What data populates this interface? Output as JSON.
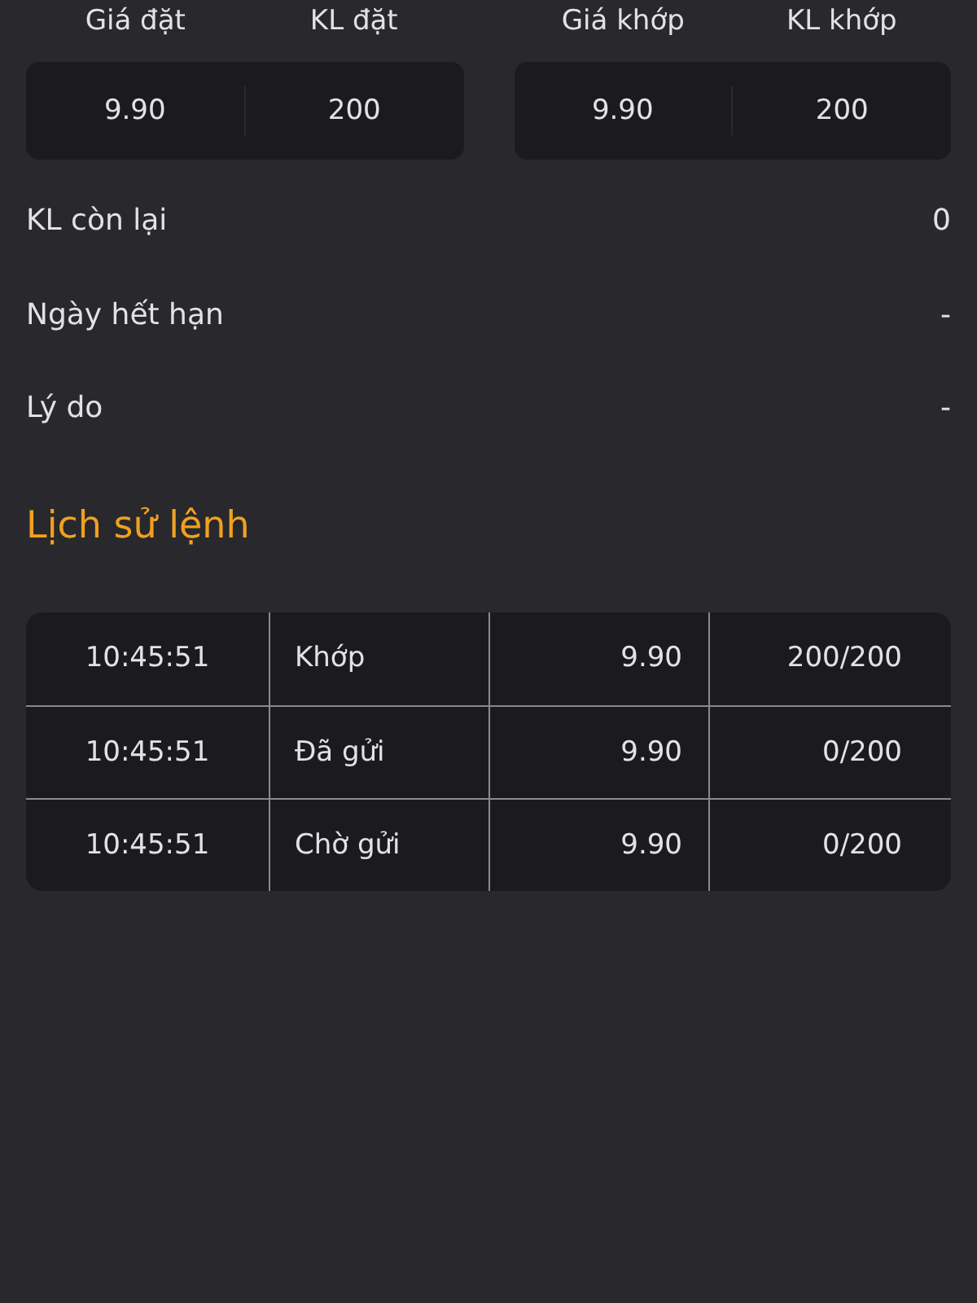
{
  "summary": [
    {
      "columns": [
        {
          "label": "Giá đặt",
          "value": "9.90"
        },
        {
          "label": "KL đặt",
          "value": "200"
        }
      ]
    },
    {
      "columns": [
        {
          "label": "Giá khớp",
          "value": "9.90"
        },
        {
          "label": "KL khớp",
          "value": "200"
        }
      ]
    }
  ],
  "details": [
    {
      "label": "KL còn lại",
      "value": "0"
    },
    {
      "label": "Ngày hết hạn",
      "value": "-"
    },
    {
      "label": "Lý do",
      "value": "-"
    }
  ],
  "history": {
    "title": "Lịch sử lệnh",
    "rows": [
      {
        "time": "10:45:51",
        "status": "Khớp",
        "price": "9.90",
        "quantity": "200/200"
      },
      {
        "time": "10:45:51",
        "status": "Đã gửi",
        "price": "9.90",
        "quantity": "0/200"
      },
      {
        "time": "10:45:51",
        "status": "Chờ gửi",
        "price": "9.90",
        "quantity": "0/200"
      }
    ]
  }
}
